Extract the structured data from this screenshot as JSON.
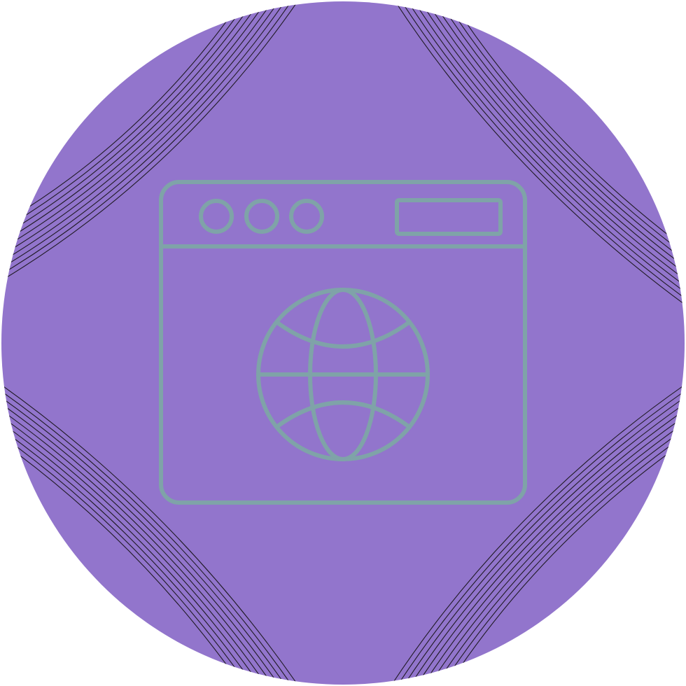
{
  "icon": {
    "name": "web-browser-globe-icon",
    "depicts": [
      "browser-window",
      "window-control-dots",
      "address-bar",
      "globe"
    ]
  },
  "colors": {
    "background": "#9275cc",
    "line_art": "#7fa3a8",
    "corner_stripes": "#1f1a24",
    "page": "#ffffff"
  }
}
